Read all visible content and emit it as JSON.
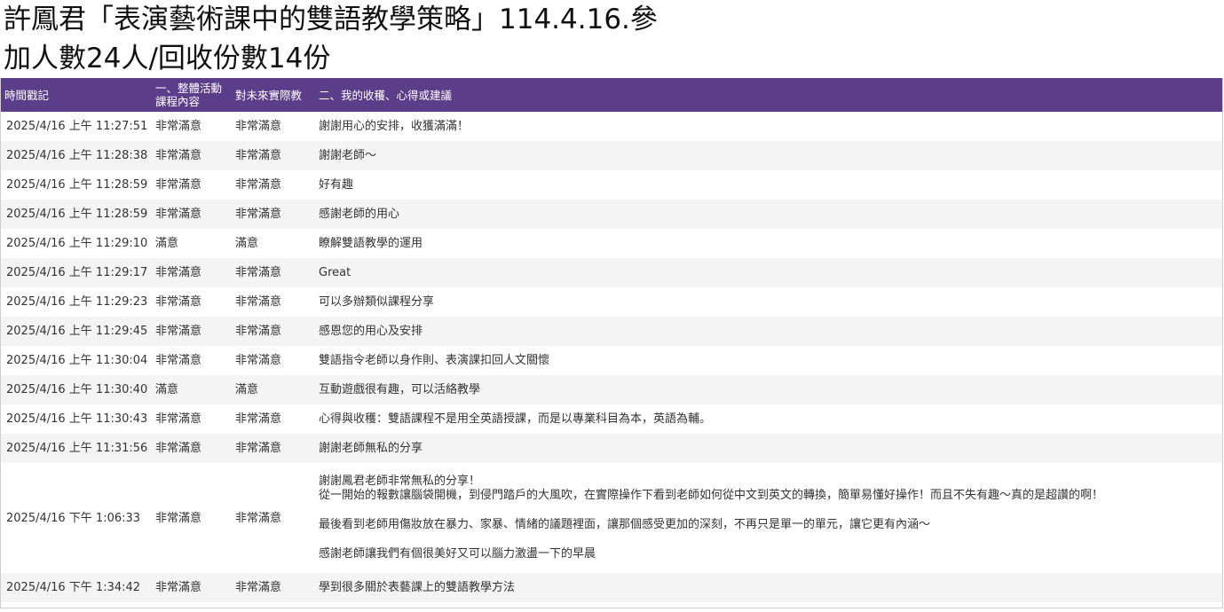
{
  "heading": {
    "line1": "許鳳君「表演藝術課中的雙語教學策略」114.4.16.參",
    "line2": "加人數24人/回收份數14份"
  },
  "table": {
    "columns": [
      "時間戳記",
      "一、整體活動課程內容",
      "對未來實際教",
      "二、我的收穫、心得或建議"
    ],
    "rows": [
      {
        "ts": "2025/4/16 上午 11:27:51",
        "a": "非常滿意",
        "b": "非常滿意",
        "c": "謝謝用心的安排，收獲滿滿！"
      },
      {
        "ts": "2025/4/16 上午 11:28:38",
        "a": "非常滿意",
        "b": "非常滿意",
        "c": "謝謝老師～"
      },
      {
        "ts": "2025/4/16 上午 11:28:59",
        "a": "非常滿意",
        "b": "非常滿意",
        "c": "好有趣"
      },
      {
        "ts": "2025/4/16 上午 11:28:59",
        "a": "非常滿意",
        "b": "非常滿意",
        "c": "感謝老師的用心"
      },
      {
        "ts": "2025/4/16 上午 11:29:10",
        "a": "滿意",
        "b": "滿意",
        "c": "瞭解雙語教學的運用"
      },
      {
        "ts": "2025/4/16 上午 11:29:17",
        "a": "非常滿意",
        "b": "非常滿意",
        "c": "Great"
      },
      {
        "ts": "2025/4/16 上午 11:29:23",
        "a": "非常滿意",
        "b": "非常滿意",
        "c": "可以多辦類似課程分享"
      },
      {
        "ts": "2025/4/16 上午 11:29:45",
        "a": "非常滿意",
        "b": "非常滿意",
        "c": "感恩您的用心及安排"
      },
      {
        "ts": "2025/4/16 上午 11:30:04",
        "a": "非常滿意",
        "b": "非常滿意",
        "c": "雙語指令老師以身作則、表演課扣回人文關懷"
      },
      {
        "ts": "2025/4/16 上午 11:30:40",
        "a": "滿意",
        "b": "滿意",
        "c": "互動遊戲很有趣，可以活絡教學"
      },
      {
        "ts": "2025/4/16 上午 11:30:43",
        "a": "非常滿意",
        "b": "非常滿意",
        "c": "心得與收穫：雙語課程不是用全英語授課，而是以專業科目為本，英語為輔。"
      },
      {
        "ts": "2025/4/16 上午 11:31:56",
        "a": "非常滿意",
        "b": "非常滿意",
        "c": "謝謝老師無私的分享"
      },
      {
        "ts": "2025/4/16 下午 1:06:33",
        "a": "非常滿意",
        "b": "非常滿意",
        "c": "謝謝鳳君老師非常無私的分享！\n從一開始的報數讓腦袋開機，到侵門踏戶的大風吹，在實際操作下看到老師如何從中文到英文的轉換，簡單易懂好操作！而且不失有趣～真的是超讚的啊！\n\n最後看到老師用傷妝放在暴力、家暴、情緒的議題裡面，讓那個感受更加的深刻，不再只是單一的單元，讓它更有內涵～\n\n感謝老師讓我們有個很美好又可以腦力激盪一下的早晨"
      },
      {
        "ts": "2025/4/16 下午 1:34:42",
        "a": "非常滿意",
        "b": "非常滿意",
        "c": "學到很多關於表藝課上的雙語教學方法"
      }
    ]
  }
}
